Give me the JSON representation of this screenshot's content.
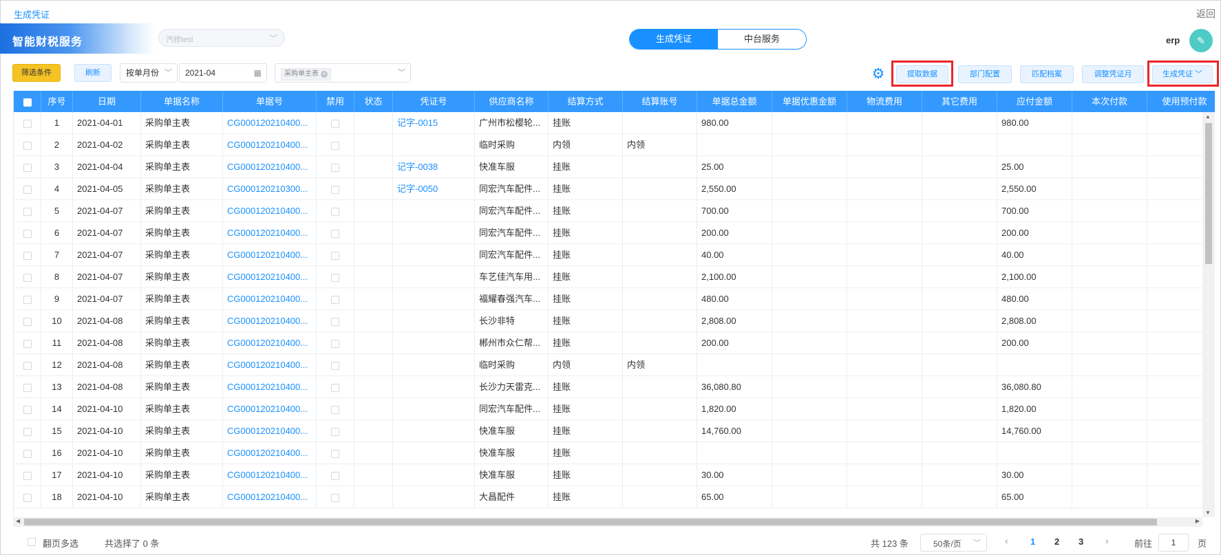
{
  "topbar": {
    "breadcrumb": "生成凭证",
    "back": "返回"
  },
  "header": {
    "brand": "智能财税服务",
    "company": "汽修test",
    "segment": {
      "active": "生成凭证",
      "inactive": "中台服务"
    },
    "user": "erp"
  },
  "toolbar": {
    "filter": "筛选条件",
    "refresh": "刷新",
    "period_mode": "按单月份",
    "month": "2021-04",
    "doc_type_tag": "采购单主表",
    "fetch_data": "提取数据",
    "dept_config": "部门配置",
    "match_archive": "匹配档案",
    "adjust_month": "调整凭证月",
    "generate": "生成凭证"
  },
  "colors": {
    "accent": "#1890ff",
    "header_bg": "#3399ff",
    "highlight": "#e8262b",
    "filter_btn": "#f5c324"
  },
  "table": {
    "columns": [
      "",
      "序号",
      "日期",
      "单据名称",
      "单据号",
      "禁用",
      "状态",
      "凭证号",
      "供应商名称",
      "结算方式",
      "结算账号",
      "单据总金额",
      "单据优惠金额",
      "物流费用",
      "其它费用",
      "应付金额",
      "本次付款",
      "使用预付款"
    ],
    "rows": [
      {
        "no": "1",
        "date": "2021-04-01",
        "name": "采购单主表",
        "doc": "CG000120210400...",
        "voucher": "记字-0015",
        "supplier": "广州市松樱轮...",
        "settle": "挂账",
        "account": "",
        "total": "980.00",
        "payable": "980.00"
      },
      {
        "no": "2",
        "date": "2021-04-02",
        "name": "采购单主表",
        "doc": "CG000120210400...",
        "voucher": "",
        "supplier": "临时采购",
        "settle": "内领",
        "account": "内领",
        "total": "",
        "payable": ""
      },
      {
        "no": "3",
        "date": "2021-04-04",
        "name": "采购单主表",
        "doc": "CG000120210400...",
        "voucher": "记字-0038",
        "supplier": "快准车服",
        "settle": "挂账",
        "account": "",
        "total": "25.00",
        "payable": "25.00"
      },
      {
        "no": "4",
        "date": "2021-04-05",
        "name": "采购单主表",
        "doc": "CG000120210300...",
        "voucher": "记字-0050",
        "supplier": "同宏汽车配件...",
        "settle": "挂账",
        "account": "",
        "total": "2,550.00",
        "payable": "2,550.00"
      },
      {
        "no": "5",
        "date": "2021-04-07",
        "name": "采购单主表",
        "doc": "CG000120210400...",
        "voucher": "",
        "supplier": "同宏汽车配件...",
        "settle": "挂账",
        "account": "",
        "total": "700.00",
        "payable": "700.00"
      },
      {
        "no": "6",
        "date": "2021-04-07",
        "name": "采购单主表",
        "doc": "CG000120210400...",
        "voucher": "",
        "supplier": "同宏汽车配件...",
        "settle": "挂账",
        "account": "",
        "total": "200.00",
        "payable": "200.00"
      },
      {
        "no": "7",
        "date": "2021-04-07",
        "name": "采购单主表",
        "doc": "CG000120210400...",
        "voucher": "",
        "supplier": "同宏汽车配件...",
        "settle": "挂账",
        "account": "",
        "total": "40.00",
        "payable": "40.00"
      },
      {
        "no": "8",
        "date": "2021-04-07",
        "name": "采购单主表",
        "doc": "CG000120210400...",
        "voucher": "",
        "supplier": "车艺佳汽车用...",
        "settle": "挂账",
        "account": "",
        "total": "2,100.00",
        "payable": "2,100.00"
      },
      {
        "no": "9",
        "date": "2021-04-07",
        "name": "采购单主表",
        "doc": "CG000120210400...",
        "voucher": "",
        "supplier": "福耀春强汽车...",
        "settle": "挂账",
        "account": "",
        "total": "480.00",
        "payable": "480.00"
      },
      {
        "no": "10",
        "date": "2021-04-08",
        "name": "采购单主表",
        "doc": "CG000120210400...",
        "voucher": "",
        "supplier": "长沙非特",
        "settle": "挂账",
        "account": "",
        "total": "2,808.00",
        "payable": "2,808.00"
      },
      {
        "no": "11",
        "date": "2021-04-08",
        "name": "采购单主表",
        "doc": "CG000120210400...",
        "voucher": "",
        "supplier": "郴州市众仁帮...",
        "settle": "挂账",
        "account": "",
        "total": "200.00",
        "payable": "200.00"
      },
      {
        "no": "12",
        "date": "2021-04-08",
        "name": "采购单主表",
        "doc": "CG000120210400...",
        "voucher": "",
        "supplier": "临时采购",
        "settle": "内领",
        "account": "内领",
        "total": "",
        "payable": ""
      },
      {
        "no": "13",
        "date": "2021-04-08",
        "name": "采购单主表",
        "doc": "CG000120210400...",
        "voucher": "",
        "supplier": "长沙力天雷克...",
        "settle": "挂账",
        "account": "",
        "total": "36,080.80",
        "payable": "36,080.80"
      },
      {
        "no": "14",
        "date": "2021-04-10",
        "name": "采购单主表",
        "doc": "CG000120210400...",
        "voucher": "",
        "supplier": "同宏汽车配件...",
        "settle": "挂账",
        "account": "",
        "total": "1,820.00",
        "payable": "1,820.00"
      },
      {
        "no": "15",
        "date": "2021-04-10",
        "name": "采购单主表",
        "doc": "CG000120210400...",
        "voucher": "",
        "supplier": "快准车服",
        "settle": "挂账",
        "account": "",
        "total": "14,760.00",
        "payable": "14,760.00"
      },
      {
        "no": "16",
        "date": "2021-04-10",
        "name": "采购单主表",
        "doc": "CG000120210400...",
        "voucher": "",
        "supplier": "快准车服",
        "settle": "挂账",
        "account": "",
        "total": "",
        "payable": ""
      },
      {
        "no": "17",
        "date": "2021-04-10",
        "name": "采购单主表",
        "doc": "CG000120210400...",
        "voucher": "",
        "supplier": "快准车服",
        "settle": "挂账",
        "account": "",
        "total": "30.00",
        "payable": "30.00"
      },
      {
        "no": "18",
        "date": "2021-04-10",
        "name": "采购单主表",
        "doc": "CG000120210400...",
        "voucher": "",
        "supplier": "大昌配件",
        "settle": "挂账",
        "account": "",
        "total": "65.00",
        "payable": "65.00"
      }
    ]
  },
  "footer": {
    "cross_page": "翻页多选",
    "selected": "共选择了 0 条",
    "total": "共 123 条",
    "page_size": "50条/页",
    "pages": [
      "1",
      "2",
      "3"
    ],
    "current_page": "1",
    "goto_label": "前往",
    "goto_value": "1",
    "goto_suffix": "页"
  }
}
